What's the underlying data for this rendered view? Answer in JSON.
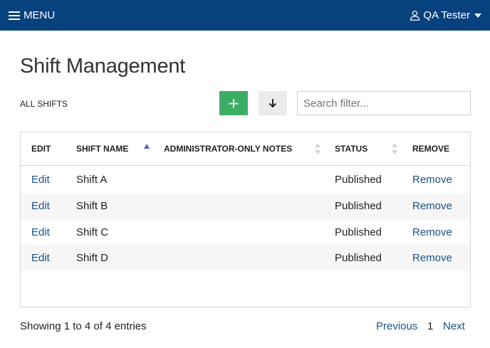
{
  "topbar": {
    "menu_label": "MENU",
    "user_name": "QA Tester",
    "background": "#07417e"
  },
  "page": {
    "title": "Shift Management"
  },
  "toolbar": {
    "section_label": "ALL SHIFTS",
    "add_symbol": "+",
    "add_color": "#3cae63",
    "search_placeholder": "Search filter...",
    "search_value": ""
  },
  "table": {
    "columns": [
      {
        "label": "EDIT",
        "sort": "none"
      },
      {
        "label": "SHIFT NAME",
        "sort": "ascending"
      },
      {
        "label": "ADMINISTRATOR-ONLY NOTES",
        "sort": "sortable"
      },
      {
        "label": "STATUS",
        "sort": "sortable"
      },
      {
        "label": "REMOVE",
        "sort": "none"
      }
    ],
    "rows": [
      {
        "edit": "Edit",
        "name": "Shift A",
        "notes": "",
        "status": "Published",
        "remove": "Remove"
      },
      {
        "edit": "Edit",
        "name": "Shift B",
        "notes": "",
        "status": "Published",
        "remove": "Remove"
      },
      {
        "edit": "Edit",
        "name": "Shift C",
        "notes": "",
        "status": "Published",
        "remove": "Remove"
      },
      {
        "edit": "Edit",
        "name": "Shift D",
        "notes": "",
        "status": "Published",
        "remove": "Remove"
      }
    ]
  },
  "footer": {
    "info": "Showing 1 to 4 of 4 entries",
    "previous": "Previous",
    "current_page": "1",
    "next": "Next"
  },
  "icons": {
    "menu": "hamburger-icon",
    "user": "user-icon",
    "dropdown": "caret-down-icon",
    "add": "plus-icon",
    "download": "arrow-down-icon"
  }
}
